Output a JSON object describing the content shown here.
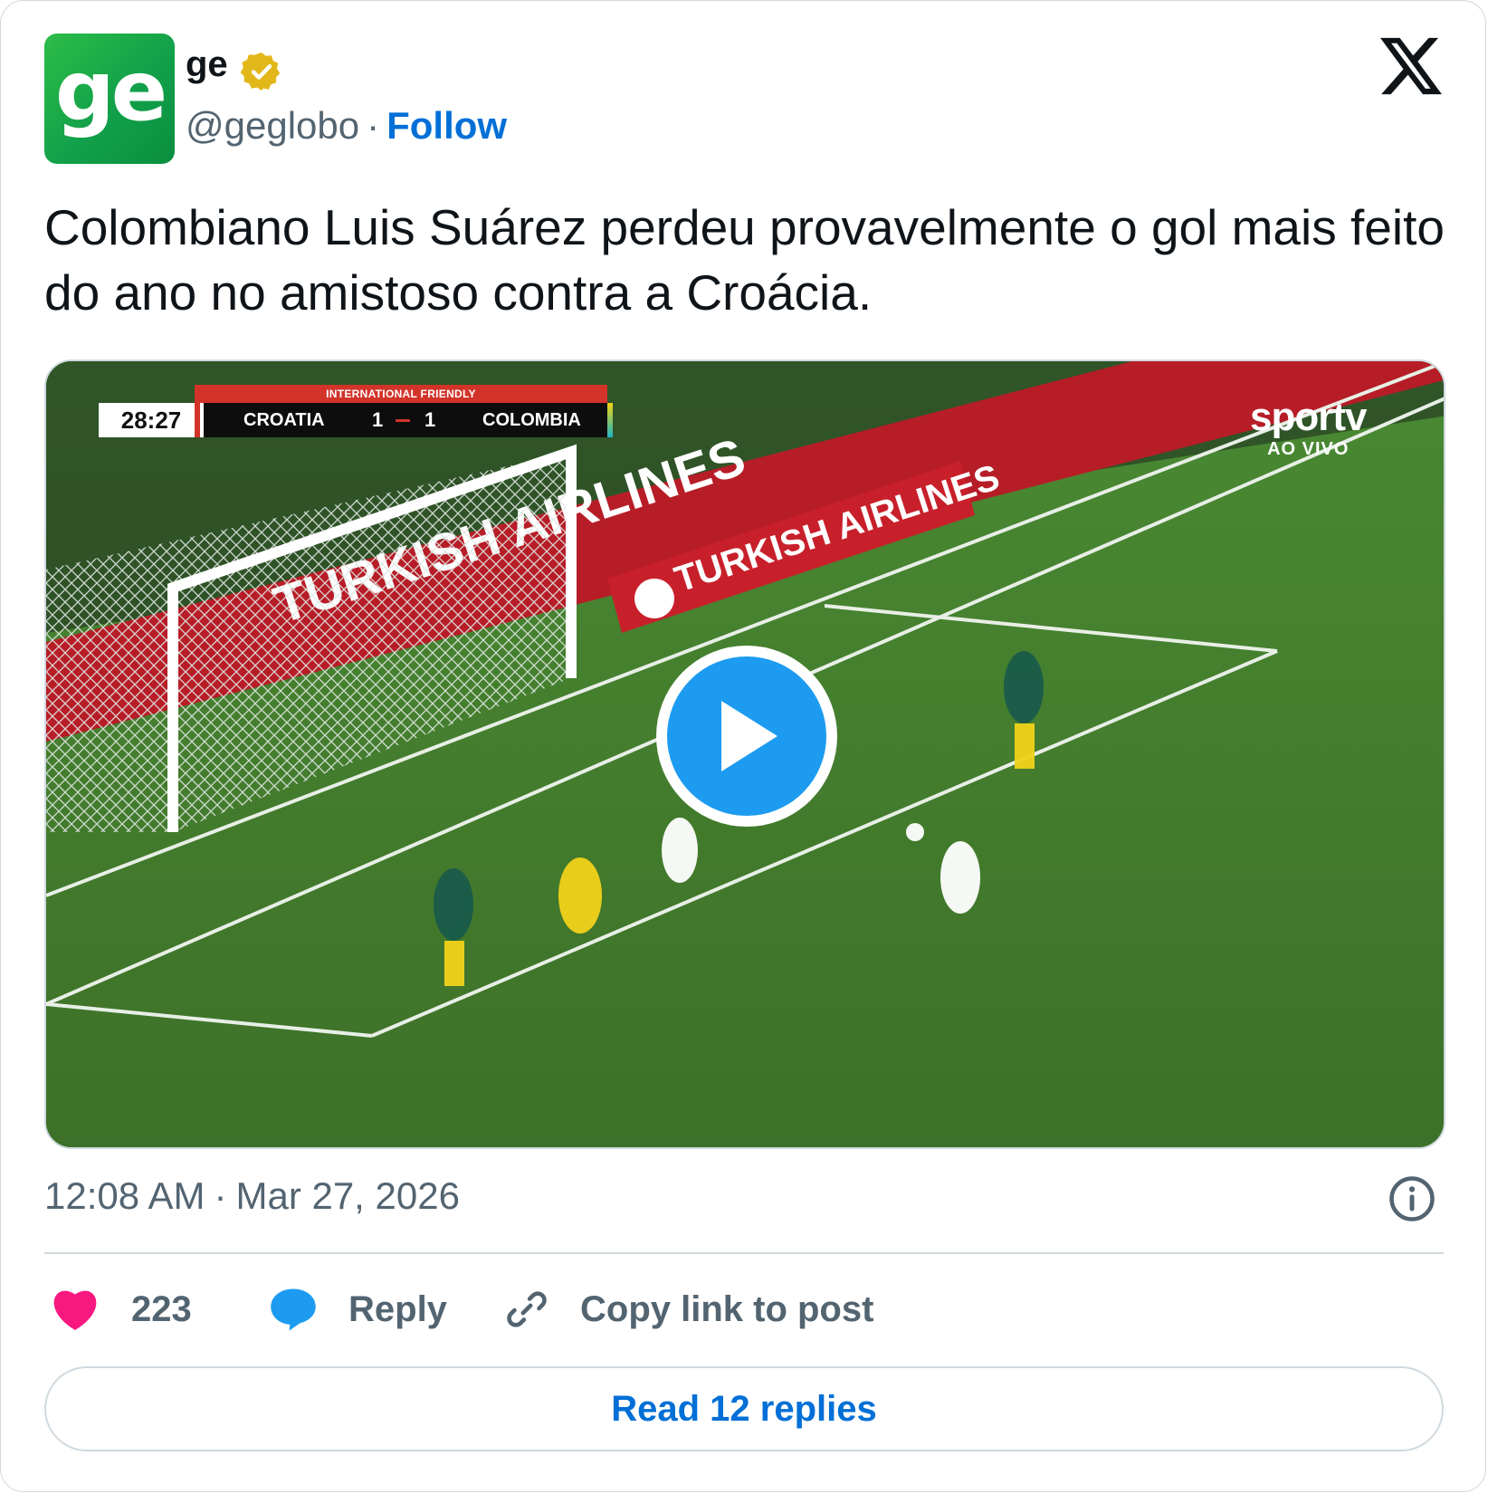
{
  "author": {
    "avatar_text": "ge",
    "name": "ge",
    "handle": "@geglobo",
    "separator": "·",
    "follow_label": "Follow"
  },
  "post": {
    "text": "Colombiano Luis Suárez perdeu provavelmente o gol mais feito do ano no amistoso contra a Croácia."
  },
  "media": {
    "scoreboard": {
      "label": "INTERNATIONAL FRIENDLY",
      "clock": "28:27",
      "team_home": "CROATIA",
      "score_home": "1",
      "score_away": "1",
      "team_away": "COLOMBIA"
    },
    "broadcaster": "sportv",
    "broadcaster_sub": "AO VIVO",
    "board_text": "TURKISH AIRLINES"
  },
  "meta": {
    "time": "12:08 AM",
    "separator": "·",
    "date": "Mar 27, 2026"
  },
  "actions": {
    "like_count": "223",
    "reply_label": "Reply",
    "copy_label": "Copy link to post"
  },
  "read_replies_label": "Read 12 replies",
  "colors": {
    "accent": "#1d9bf0",
    "link": "#006fd6",
    "like": "#f91880",
    "muted": "#536471",
    "verified_gold": "#e2b719"
  }
}
